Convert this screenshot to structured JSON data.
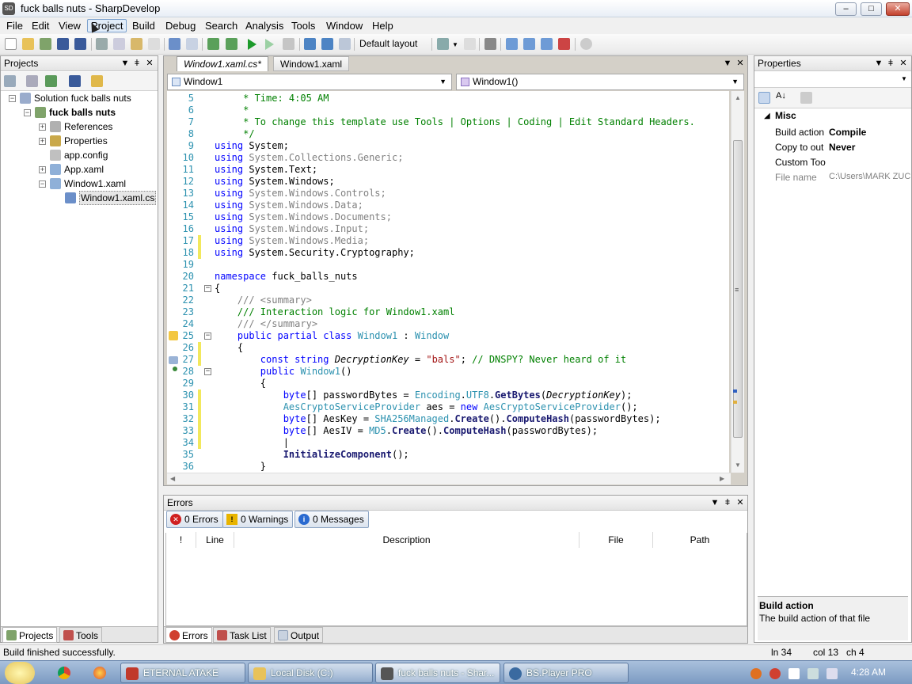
{
  "window": {
    "title": "fuck balls nuts - SharpDevelop",
    "min": "–",
    "max": "□",
    "close": "✕",
    "app_icon_text": "SD"
  },
  "menu": [
    "File",
    "Edit",
    "View",
    "Project",
    "Build",
    "Debug",
    "Search",
    "Analysis",
    "Tools",
    "Window",
    "Help"
  ],
  "toolbar": {
    "layout_label": "Default layout"
  },
  "projects_panel": {
    "title": "Projects",
    "tree": [
      {
        "label": "Solution fuck balls nuts",
        "indent": 0,
        "exp": "−"
      },
      {
        "label": "fuck balls nuts",
        "indent": 1,
        "exp": "−",
        "bold": true
      },
      {
        "label": "References",
        "indent": 2,
        "exp": "+"
      },
      {
        "label": "Properties",
        "indent": 2,
        "exp": "+"
      },
      {
        "label": "app.config",
        "indent": 2,
        "exp": ""
      },
      {
        "label": "App.xaml",
        "indent": 2,
        "exp": "+"
      },
      {
        "label": "Window1.xaml",
        "indent": 2,
        "exp": "−"
      },
      {
        "label": "Window1.xaml.cs",
        "indent": 3,
        "exp": "",
        "selected": true
      }
    ],
    "tabs": [
      "Projects",
      "Tools"
    ]
  },
  "editor": {
    "tabs": [
      "Window1.xaml.cs*",
      "Window1.xaml"
    ],
    "class_combo": "Window1",
    "member_combo": "Window1()"
  },
  "code_lines": [
    {
      "n": "5",
      "segs": [
        [
          "cm",
          "     * Time: 4:05 AM"
        ]
      ]
    },
    {
      "n": "6",
      "segs": [
        [
          "cm",
          "     *"
        ]
      ]
    },
    {
      "n": "7",
      "segs": [
        [
          "cm",
          "     * To change this template use Tools | Options | Coding | Edit Standard Headers."
        ]
      ]
    },
    {
      "n": "8",
      "segs": [
        [
          "cm",
          "     */"
        ]
      ]
    },
    {
      "n": "9",
      "segs": [
        [
          "kw",
          "using"
        ],
        [
          "",
          " System;"
        ]
      ]
    },
    {
      "n": "10",
      "segs": [
        [
          "kw",
          "using"
        ],
        [
          "gy",
          " System.Collections.Generic;"
        ]
      ]
    },
    {
      "n": "11",
      "segs": [
        [
          "kw",
          "using"
        ],
        [
          "",
          " System.Text;"
        ]
      ]
    },
    {
      "n": "12",
      "segs": [
        [
          "kw",
          "using"
        ],
        [
          "",
          " System.Windows;"
        ]
      ]
    },
    {
      "n": "13",
      "segs": [
        [
          "kw",
          "using"
        ],
        [
          "gy",
          " System.Windows.Controls;"
        ]
      ]
    },
    {
      "n": "14",
      "segs": [
        [
          "kw",
          "using"
        ],
        [
          "gy",
          " System.Windows.Data;"
        ]
      ]
    },
    {
      "n": "15",
      "segs": [
        [
          "kw",
          "using"
        ],
        [
          "gy",
          " System.Windows.Documents;"
        ]
      ]
    },
    {
      "n": "16",
      "segs": [
        [
          "kw",
          "using"
        ],
        [
          "gy",
          " System.Windows.Input;"
        ]
      ]
    },
    {
      "n": "17",
      "segs": [
        [
          "kw",
          "using"
        ],
        [
          "gy",
          " System.Windows.Media;"
        ]
      ],
      "bar": true
    },
    {
      "n": "18",
      "segs": [
        [
          "kw",
          "using"
        ],
        [
          "",
          " System.Security.Cryptography;"
        ]
      ],
      "bar": true
    },
    {
      "n": "19",
      "segs": []
    },
    {
      "n": "20",
      "segs": [
        [
          "kw",
          "namespace"
        ],
        [
          "",
          " fuck_balls_nuts"
        ]
      ]
    },
    {
      "n": "21",
      "segs": [
        [
          "",
          "{"
        ]
      ],
      "fold": "−"
    },
    {
      "n": "22",
      "segs": [
        [
          "gy",
          "    /// <summary>"
        ]
      ]
    },
    {
      "n": "23",
      "segs": [
        [
          "cm",
          "    /// Interaction logic for Window1.xaml"
        ]
      ]
    },
    {
      "n": "24",
      "segs": [
        [
          "gy",
          "    /// </summary>"
        ]
      ]
    },
    {
      "n": "25",
      "segs": [
        [
          "kw",
          "    public partial class"
        ],
        [
          "",
          " "
        ],
        [
          "ty",
          "Window1"
        ],
        [
          "",
          " : "
        ],
        [
          "ty",
          "Window"
        ]
      ],
      "fold": "−"
    },
    {
      "n": "26",
      "segs": [
        [
          "",
          "    {"
        ]
      ],
      "bar": true
    },
    {
      "n": "27",
      "segs": [
        [
          "kw",
          "        const string"
        ],
        [
          "it",
          " DecryptionKey"
        ],
        [
          "",
          " = "
        ],
        [
          "st",
          "\"bals\""
        ],
        [
          "",
          "; "
        ],
        [
          "cm",
          "// DNSPY? Never heard of it"
        ]
      ],
      "bar": true
    },
    {
      "n": "28",
      "segs": [
        [
          "kw",
          "        public"
        ],
        [
          "",
          " "
        ],
        [
          "ty",
          "Window1"
        ],
        [
          "",
          "()"
        ]
      ],
      "fold": "−"
    },
    {
      "n": "29",
      "segs": [
        [
          "",
          "        {"
        ]
      ]
    },
    {
      "n": "30",
      "segs": [
        [
          "kw",
          "            byte"
        ],
        [
          "",
          "[] passwordBytes = "
        ],
        [
          "ty",
          "Encoding"
        ],
        [
          "",
          "."
        ],
        [
          "ty",
          "UTF8"
        ],
        [
          "",
          "."
        ],
        [
          "mt",
          "GetBytes"
        ],
        [
          "",
          "("
        ],
        [
          "it",
          "DecryptionKey"
        ],
        [
          "",
          ");"
        ]
      ],
      "bar": true
    },
    {
      "n": "31",
      "segs": [
        [
          "ty",
          "            AesCryptoServiceProvider"
        ],
        [
          "",
          " aes = "
        ],
        [
          "kw",
          "new"
        ],
        [
          "",
          " "
        ],
        [
          "ty",
          "AesCryptoServiceProvider"
        ],
        [
          "",
          "();"
        ]
      ],
      "bar": true
    },
    {
      "n": "32",
      "segs": [
        [
          "kw",
          "            byte"
        ],
        [
          "",
          "[] AesKey = "
        ],
        [
          "ty",
          "SHA256Managed"
        ],
        [
          "",
          "."
        ],
        [
          "mt",
          "Create"
        ],
        [
          "",
          "()."
        ],
        [
          "mt",
          "ComputeHash"
        ],
        [
          "",
          "(passwordBytes);"
        ]
      ],
      "bar": true
    },
    {
      "n": "33",
      "segs": [
        [
          "kw",
          "            byte"
        ],
        [
          "",
          "[] AesIV = "
        ],
        [
          "ty",
          "MD5"
        ],
        [
          "",
          "."
        ],
        [
          "mt",
          "Create"
        ],
        [
          "",
          "()."
        ],
        [
          "mt",
          "ComputeHash"
        ],
        [
          "",
          "(passwordBytes);"
        ]
      ],
      "bar": true
    },
    {
      "n": "34",
      "segs": [
        [
          "",
          "            |"
        ]
      ],
      "bar": true
    },
    {
      "n": "35",
      "segs": [
        [
          "mt",
          "            InitializeComponent"
        ],
        [
          "",
          "();"
        ]
      ]
    },
    {
      "n": "36",
      "segs": [
        [
          "",
          "        }"
        ]
      ]
    }
  ],
  "properties_panel": {
    "title": "Properties",
    "category": "Misc",
    "rows": [
      {
        "name": "Build action",
        "value": "Compile",
        "bold": true
      },
      {
        "name": "Copy to out",
        "value": "Never",
        "bold": true
      },
      {
        "name": "Custom Too",
        "value": "",
        "bold": false
      },
      {
        "name": "File name",
        "value": "C:\\Users\\MARK ZUC",
        "grey": true
      }
    ],
    "desc_title": "Build action",
    "desc_text": "The build action of that file"
  },
  "errors_panel": {
    "title": "Errors",
    "errors": "0 Errors",
    "warnings": "0 Warnings",
    "messages": "0 Messages",
    "columns": [
      "!",
      "Line",
      "Description",
      "File",
      "Path"
    ],
    "tabs": [
      "Errors",
      "Task List",
      "Output"
    ]
  },
  "status": {
    "message": "Build finished successfully.",
    "ln": "ln 34",
    "col": "col 13",
    "ch": "ch 4"
  },
  "taskbar": {
    "items": [
      "ETERNAL ATAKE",
      "Local Disk (C:)",
      "fuck balls nuts - Shar...",
      "BS.Player PRO"
    ],
    "clock": "4:28 AM"
  }
}
